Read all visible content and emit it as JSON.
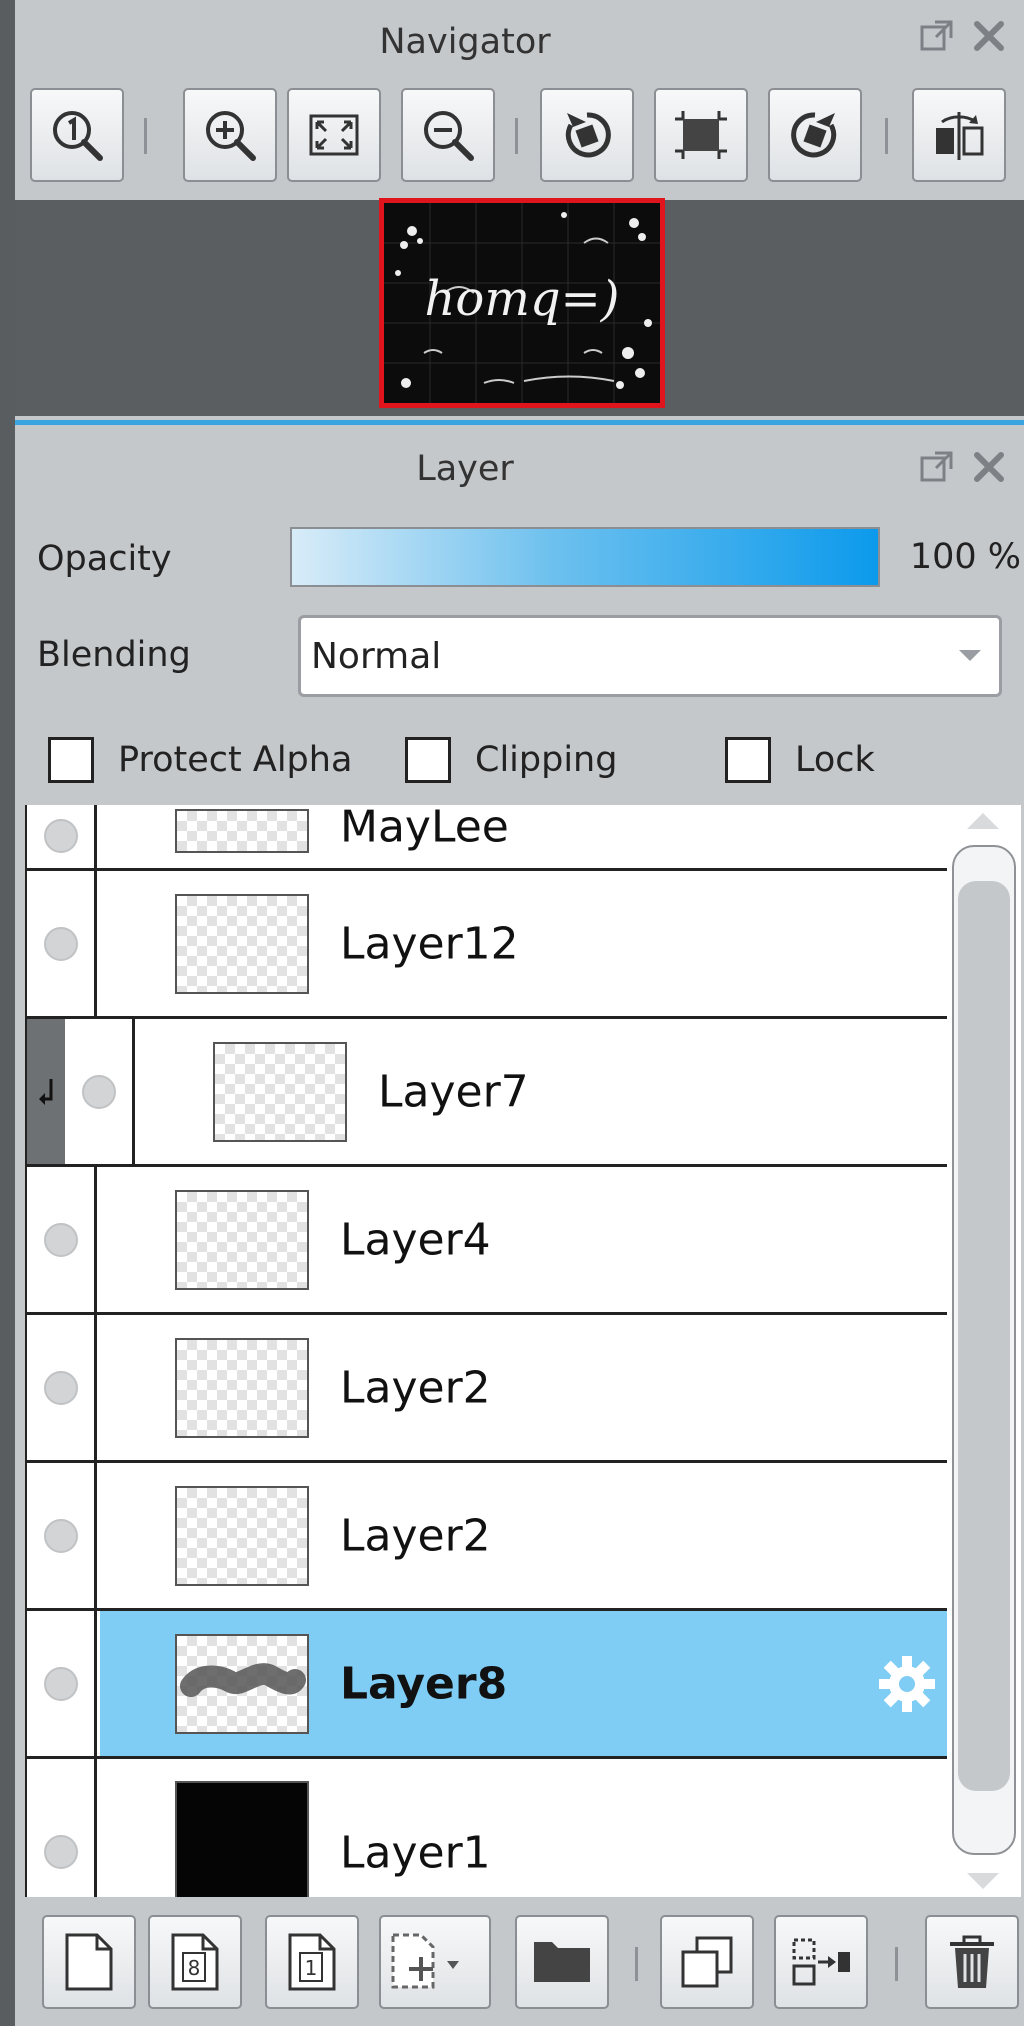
{
  "navigator": {
    "title": "Navigator",
    "toolbar": {
      "actual_size": "zoom-actual-size-icon",
      "zoom_in": "zoom-in-icon",
      "fit": "fit-window-icon",
      "zoom_out": "zoom-out-icon",
      "rotate_left": "rotate-left-icon",
      "reset_rotation": "reset-rotation-icon",
      "rotate_right": "rotate-right-icon",
      "flip": "flip-horizontal-icon"
    },
    "preview_text": "homq=)"
  },
  "layer_panel": {
    "title": "Layer",
    "opacity_label": "Opacity",
    "opacity_value": "100 %",
    "opacity_fraction": 1.0,
    "blending_label": "Blending",
    "blending_value": "Normal",
    "checks": {
      "protect_alpha": "Protect Alpha",
      "clipping": "Clipping",
      "lock": "Lock"
    },
    "layers": [
      {
        "name": "MayLee"
      },
      {
        "name": "Layer12"
      },
      {
        "name": "Layer7"
      },
      {
        "name": "Layer4"
      },
      {
        "name": "Layer2"
      },
      {
        "name": "Layer2"
      },
      {
        "name": "Layer8"
      },
      {
        "name": "Layer1"
      }
    ],
    "toolbar_thumb_labels": {
      "new_8bit": "8",
      "new_1bit": "1"
    }
  },
  "colors": {
    "accent_blue": "#0c9aec",
    "selected_row": "#7fccf4",
    "preview_frame": "#e0141c"
  }
}
